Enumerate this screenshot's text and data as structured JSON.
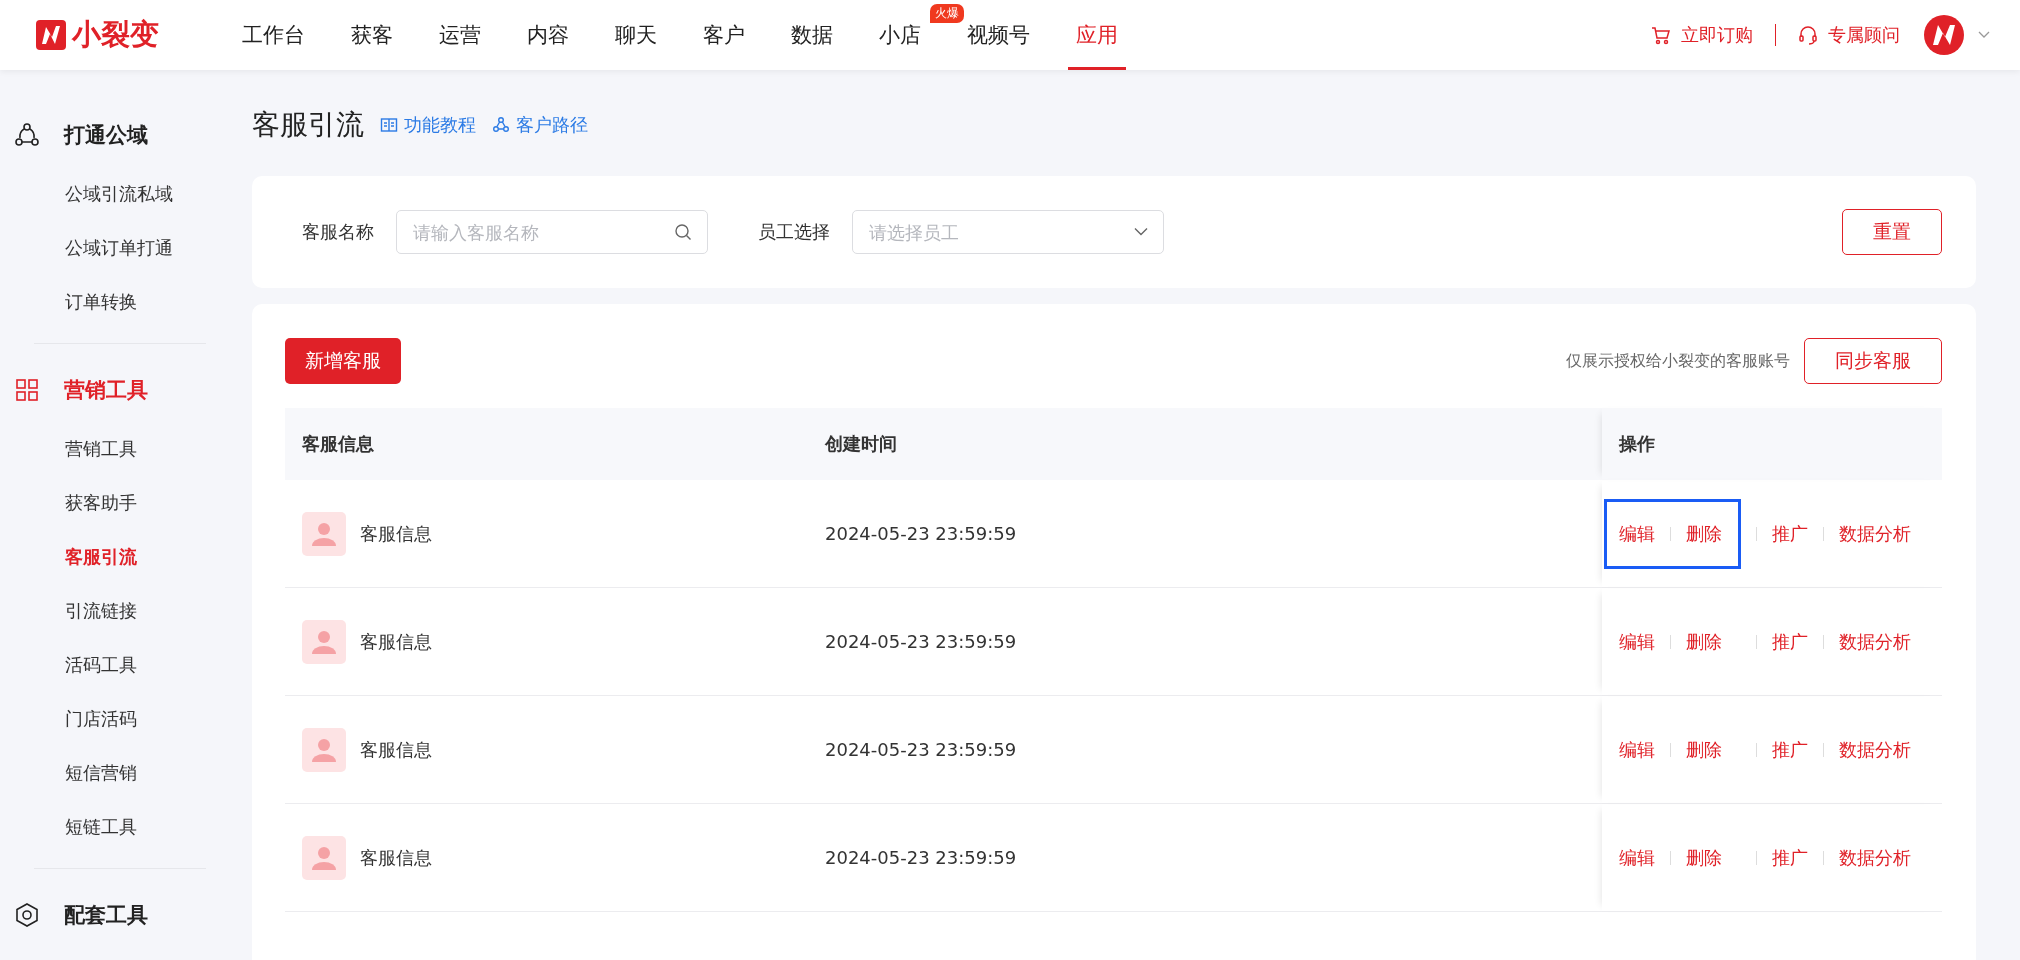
{
  "logo": {
    "text": "小裂变"
  },
  "nav": [
    {
      "label": "工作台",
      "selected": false
    },
    {
      "label": "获客",
      "selected": false
    },
    {
      "label": "运营",
      "selected": false
    },
    {
      "label": "内容",
      "selected": false
    },
    {
      "label": "聊天",
      "selected": false
    },
    {
      "label": "客户",
      "selected": false
    },
    {
      "label": "数据",
      "selected": false
    },
    {
      "label": "小店",
      "selected": false,
      "badge": "火爆"
    },
    {
      "label": "视频号",
      "selected": false
    },
    {
      "label": "应用",
      "selected": true
    }
  ],
  "header_actions": [
    {
      "label": "立即订购",
      "kind": "cart"
    },
    {
      "label": "专属顾问",
      "kind": "headset"
    }
  ],
  "sidebar": [
    {
      "title": "打通公域",
      "selected": false,
      "items": [
        {
          "label": "公域引流私域",
          "selected": false
        },
        {
          "label": "公域订单打通",
          "selected": false
        },
        {
          "label": "订单转换",
          "selected": false
        }
      ]
    },
    {
      "title": "营销工具",
      "selected": true,
      "items": [
        {
          "label": "营销工具",
          "selected": false
        },
        {
          "label": "获客助手",
          "selected": false
        },
        {
          "label": "客服引流",
          "selected": true
        },
        {
          "label": "引流链接",
          "selected": false
        },
        {
          "label": "活码工具",
          "selected": false
        },
        {
          "label": "门店活码",
          "selected": false
        },
        {
          "label": "短信营销",
          "selected": false
        },
        {
          "label": "短链工具",
          "selected": false
        }
      ]
    },
    {
      "title": "配套工具",
      "selected": false
    }
  ],
  "page": {
    "title": "客服引流",
    "links": [
      {
        "label": "功能教程",
        "kind": "book"
      },
      {
        "label": "客户路径",
        "kind": "nodes"
      }
    ]
  },
  "filters": [
    {
      "label": "客服名称",
      "placeholder": "请输入客服名称",
      "kind": "search"
    },
    {
      "label": "员工选择",
      "placeholder": "请选择员工",
      "kind": "select"
    }
  ],
  "reset_button": "重置",
  "toolbar": {
    "add_button": "新增客服",
    "note": "仅展示授权给小裂变的客服账号",
    "sync_button": "同步客服"
  },
  "table": {
    "columns": [
      "客服信息",
      "创建时间",
      "操作"
    ],
    "rows": [
      {
        "name": "客服信息",
        "created": "2024-05-23 23:59:59",
        "actions": [
          "编辑",
          "删除",
          "推广",
          "数据分析"
        ],
        "highlighted": true
      },
      {
        "name": "客服信息",
        "created": "2024-05-23 23:59:59",
        "actions": [
          "编辑",
          "删除",
          "推广",
          "数据分析"
        ],
        "highlighted": false
      },
      {
        "name": "客服信息",
        "created": "2024-05-23 23:59:59",
        "actions": [
          "编辑",
          "删除",
          "推广",
          "数据分析"
        ],
        "highlighted": false
      },
      {
        "name": "客服信息",
        "created": "2024-05-23 23:59:59",
        "actions": [
          "编辑",
          "删除",
          "推广",
          "数据分析"
        ],
        "highlighted": false
      }
    ]
  }
}
